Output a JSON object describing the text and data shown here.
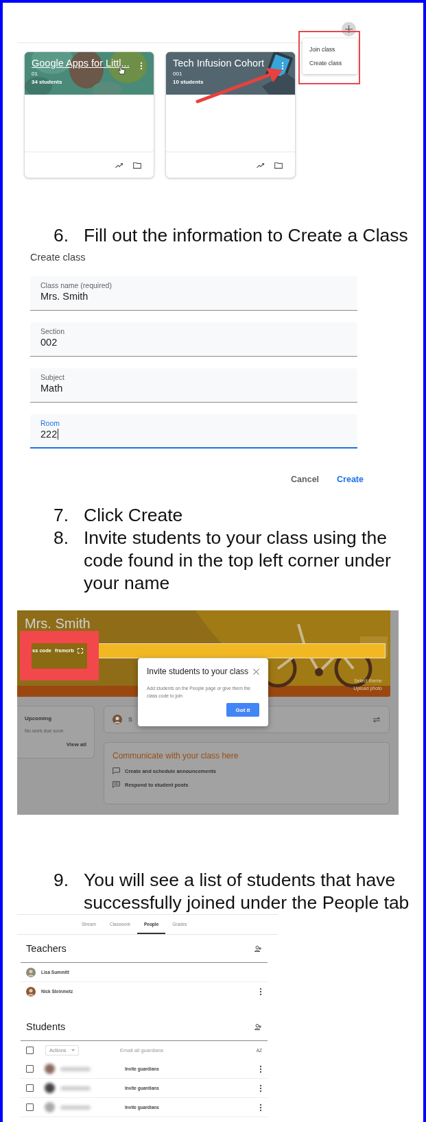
{
  "classes_screen": {
    "add_menu": {
      "items": [
        "Join class",
        "Create class"
      ]
    },
    "cards": [
      {
        "title": "Google Apps for Littl...",
        "section": "01",
        "students": "34 students",
        "hovered": true,
        "kind": "teal"
      },
      {
        "title": "Tech Infusion Cohort",
        "section": "001",
        "students": "10 students",
        "hovered": false,
        "kind": "slate"
      }
    ]
  },
  "step_6": {
    "number": "6.",
    "text": "Fill out the information to Create a Class"
  },
  "create_class": {
    "title": "Create class",
    "fields": [
      {
        "label": "Class name (required)",
        "value": "Mrs. Smith",
        "focused": false
      },
      {
        "label": "Section",
        "value": "002",
        "focused": false
      },
      {
        "label": "Subject",
        "value": "Math",
        "focused": false
      },
      {
        "label": "Room",
        "value": "222",
        "focused": true
      }
    ],
    "cancel": "Cancel",
    "create": "Create"
  },
  "steps_7_8": [
    {
      "number": "7.",
      "text": "Click Create"
    },
    {
      "number": "8.",
      "text": "Invite students to your class using the code found in the top left corner under your name"
    }
  ],
  "class_page": {
    "class_name": "Mrs. Smith",
    "class_code_label": "ss code",
    "class_code": "frsmcrb",
    "theme_links": [
      "Select theme",
      "Upload photo"
    ],
    "dialog": {
      "title": "Invite students to your class",
      "body": "Add students on the People page or give them the class code to join",
      "button": "Got it"
    },
    "upcoming": {
      "title": "Upcoming",
      "note": "No work due soon",
      "link": "View all"
    },
    "share_text": "S",
    "communicate": {
      "title": "Communicate with your class here",
      "items": [
        "Create and schedule announcements",
        "Respond to student posts"
      ]
    }
  },
  "step_9": {
    "number": "9.",
    "text": "You will see a list of students that have successfully joined under the People tab"
  },
  "people": {
    "tabs": [
      {
        "label": "Stream",
        "selected": false
      },
      {
        "label": "Classwork",
        "selected": false
      },
      {
        "label": "People",
        "selected": true
      },
      {
        "label": "Grades",
        "selected": false
      }
    ],
    "teachers": {
      "title": "Teachers",
      "rows": [
        {
          "name": "Lisa Summitt",
          "menu": false
        },
        {
          "name": "Nick Steinmetz",
          "menu": true
        }
      ]
    },
    "students": {
      "title": "Students",
      "select_all_checked": false,
      "actions": "Actions",
      "email_all": "Email all guardians",
      "sort_label": "AZ",
      "rows": [
        {
          "invite": "Invite guardians",
          "checked": false
        },
        {
          "invite": "Invite guardians",
          "checked": false
        },
        {
          "invite": "Invite guardians",
          "checked": false
        }
      ]
    }
  }
}
